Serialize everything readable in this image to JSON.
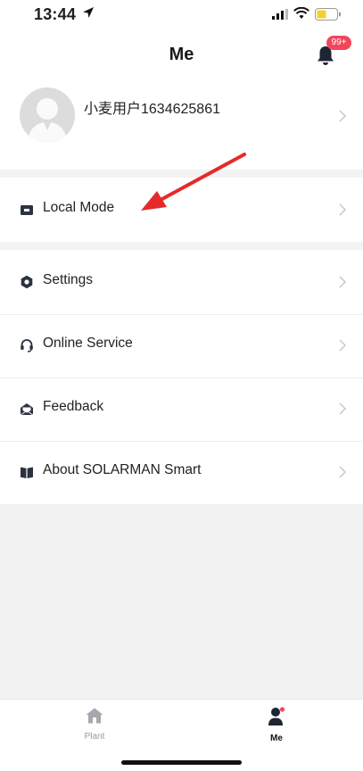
{
  "status_bar": {
    "time": "13:44"
  },
  "header": {
    "title": "Me",
    "notification_badge": "99+"
  },
  "profile": {
    "username": "小麦用户1634625861"
  },
  "menu": {
    "local_mode": "Local Mode",
    "settings": "Settings",
    "online_service": "Online Service",
    "feedback": "Feedback",
    "about": "About SOLARMAN Smart"
  },
  "tabbar": {
    "tabs": [
      {
        "label": "Plant",
        "icon": "home-icon",
        "active": false
      },
      {
        "label": "Me",
        "icon": "person-icon",
        "active": true
      }
    ]
  },
  "colors": {
    "badge": "#f1465a",
    "annotation_arrow": "#e62a2a",
    "icon_dark": "#2c3240",
    "battery": "#f5d12b"
  }
}
